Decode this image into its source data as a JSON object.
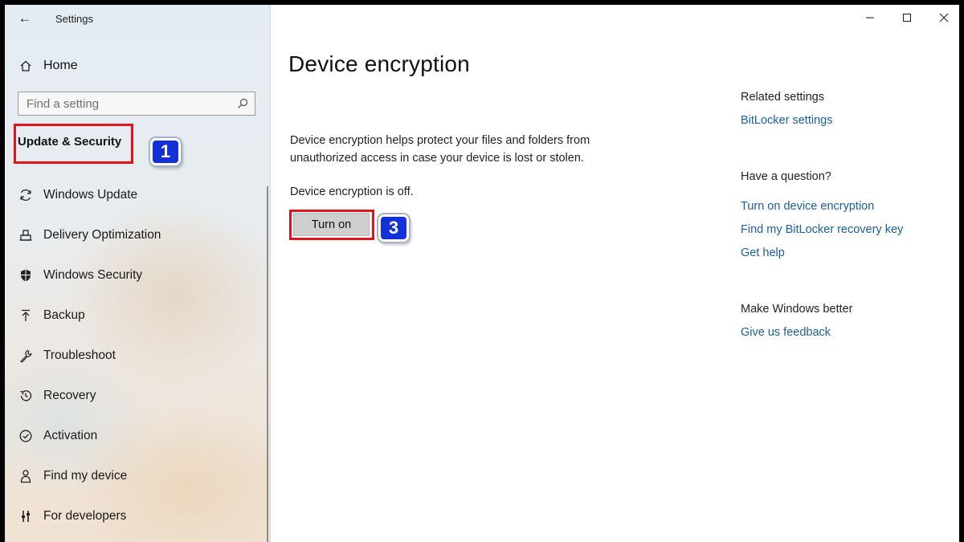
{
  "window": {
    "title": "Settings"
  },
  "sidebar": {
    "home_label": "Home",
    "search_placeholder": "Find a setting",
    "section_title": "Update & Security",
    "items": [
      {
        "label": "Windows Update",
        "icon": "sync-icon"
      },
      {
        "label": "Delivery Optimization",
        "icon": "delivery-icon"
      },
      {
        "label": "Windows Security",
        "icon": "shield-icon"
      },
      {
        "label": "Backup",
        "icon": "upload-icon"
      },
      {
        "label": "Troubleshoot",
        "icon": "wrench-icon"
      },
      {
        "label": "Recovery",
        "icon": "history-icon"
      },
      {
        "label": "Activation",
        "icon": "check-circle-icon"
      },
      {
        "label": "Find my device",
        "icon": "person-location-icon"
      },
      {
        "label": "For developers",
        "icon": "developer-tools-icon"
      }
    ]
  },
  "callouts": {
    "step1": "1",
    "step3": "3",
    "highlight_color": "#e0141b",
    "badge_color": "#1231d6"
  },
  "main": {
    "title": "Device encryption",
    "description": "Device encryption helps protect your files and folders from unauthorized access in case your device is lost or stolen.",
    "status": "Device encryption is off.",
    "turn_on_label": "Turn on"
  },
  "related": {
    "heading": "Related settings",
    "bitlocker_link": "BitLocker settings",
    "question_heading": "Have a question?",
    "links": [
      "Turn on device encryption",
      "Find my BitLocker recovery key",
      "Get help"
    ],
    "better_heading": "Make Windows better",
    "feedback_link": "Give us feedback",
    "link_color": "#1a5f9e"
  }
}
